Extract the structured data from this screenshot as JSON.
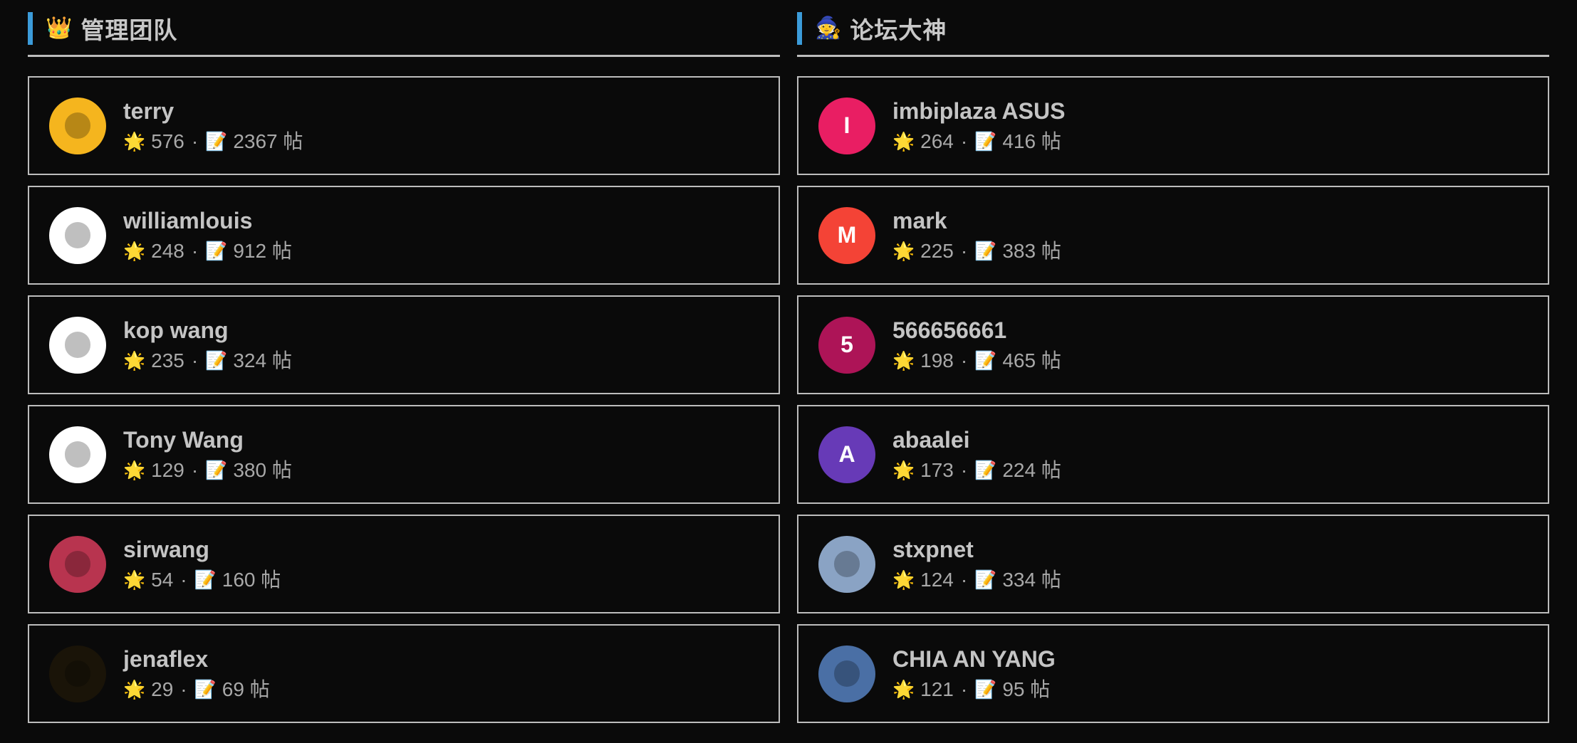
{
  "columns": [
    {
      "emoji": "👑",
      "title": "管理团队",
      "members": [
        {
          "name": "terry",
          "stars": "576",
          "posts": "2367",
          "avatar": {
            "kind": "image",
            "bg": "#f5b51e",
            "icon": "motorcycle-rider-avatar"
          }
        },
        {
          "name": "williamlouis",
          "stars": "248",
          "posts": "912",
          "avatar": {
            "kind": "image",
            "bg": "#ffffff",
            "icon": "pink-sketch-avatar"
          }
        },
        {
          "name": "kop wang",
          "stars": "235",
          "posts": "324",
          "avatar": {
            "kind": "image",
            "bg": "#ffffff",
            "icon": "sleeping-cartoon-avatar"
          }
        },
        {
          "name": "Tony Wang",
          "stars": "129",
          "posts": "380",
          "avatar": {
            "kind": "image",
            "bg": "#ffffff",
            "icon": "cartoon-man-glasses-avatar"
          }
        },
        {
          "name": "sirwang",
          "stars": "54",
          "posts": "160",
          "avatar": {
            "kind": "image",
            "bg": "#b8344f",
            "icon": "beast-head-avatar"
          }
        },
        {
          "name": "jenaflex",
          "stars": "29",
          "posts": "69",
          "avatar": {
            "kind": "image",
            "bg": "#1a1408",
            "icon": "gold-emblem-avatar"
          }
        }
      ]
    },
    {
      "emoji": "🧙",
      "title": "论坛大神",
      "members": [
        {
          "name": "imbiplaza ASUS",
          "stars": "264",
          "posts": "416",
          "avatar": {
            "kind": "letter",
            "letter": "I",
            "bg": "#e91e63"
          }
        },
        {
          "name": "mark",
          "stars": "225",
          "posts": "383",
          "avatar": {
            "kind": "letter",
            "letter": "M",
            "bg": "#f44336"
          }
        },
        {
          "name": "566656661",
          "stars": "198",
          "posts": "465",
          "avatar": {
            "kind": "letter",
            "letter": "5",
            "bg": "#ad1457"
          }
        },
        {
          "name": "abaalei",
          "stars": "173",
          "posts": "224",
          "avatar": {
            "kind": "letter",
            "letter": "A",
            "bg": "#673ab7"
          }
        },
        {
          "name": "stxpnet",
          "stars": "124",
          "posts": "334",
          "avatar": {
            "kind": "image",
            "bg": "#8aa3c4",
            "icon": "man-photo-avatar"
          }
        },
        {
          "name": "CHIA AN YANG",
          "stars": "121",
          "posts": "95",
          "avatar": {
            "kind": "image",
            "bg": "#4a6fa5",
            "icon": "child-photo-avatar"
          }
        }
      ]
    }
  ],
  "labels": {
    "star_icon": "🌟",
    "post_icon": "📝",
    "separator": "·",
    "posts_unit": "帖"
  },
  "colors": {
    "accent": "#3b9bd9",
    "border": "#bdbdbd",
    "background": "#0a0a0a"
  }
}
